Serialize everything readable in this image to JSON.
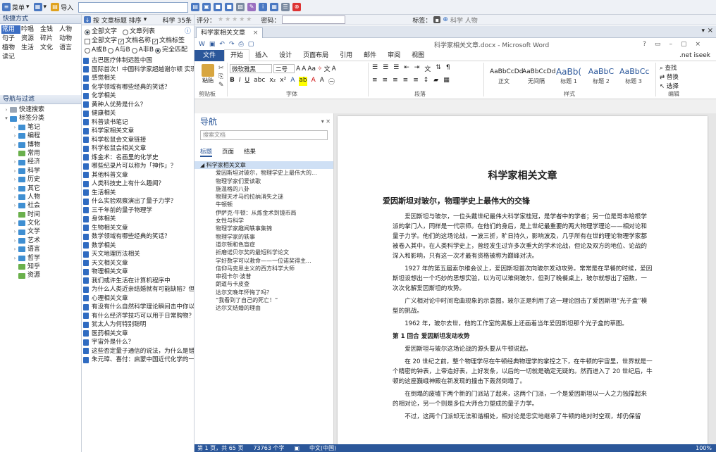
{
  "toolbar": {
    "menu": "菜单",
    "import": "导入"
  },
  "quick": {
    "title": "快捷方式",
    "items": [
      "常用",
      "吟唱",
      "金钱",
      "人物",
      "句子",
      "资源",
      "碎片",
      "动物",
      "植物",
      "生活",
      "文化",
      "语言",
      "读记"
    ],
    "selected": 0
  },
  "nav_filter": {
    "title": "导航与过滤",
    "nodes": [
      {
        "label": "快速搜索",
        "level": 0,
        "arrow": ">",
        "kind": "grey"
      },
      {
        "label": "标签分类",
        "level": 0,
        "arrow": "v",
        "kind": "folder"
      },
      {
        "label": "笔记",
        "level": 1,
        "arrow": ">",
        "kind": "folder"
      },
      {
        "label": "编程",
        "level": 1,
        "arrow": ">",
        "kind": "folder"
      },
      {
        "label": "博物",
        "level": 1,
        "arrow": ">",
        "kind": "folder"
      },
      {
        "label": "常用",
        "level": 1,
        "arrow": "",
        "kind": "leaf"
      },
      {
        "label": "经济",
        "level": 1,
        "arrow": ">",
        "kind": "folder"
      },
      {
        "label": "科学",
        "level": 1,
        "arrow": ">",
        "kind": "folder"
      },
      {
        "label": "历史",
        "level": 1,
        "arrow": ">",
        "kind": "folder"
      },
      {
        "label": "其它",
        "level": 1,
        "arrow": ">",
        "kind": "folder"
      },
      {
        "label": "人物",
        "level": 1,
        "arrow": ">",
        "kind": "folder"
      },
      {
        "label": "社会",
        "level": 1,
        "arrow": ">",
        "kind": "folder"
      },
      {
        "label": "时间",
        "level": 1,
        "arrow": "",
        "kind": "leaf"
      },
      {
        "label": "文化",
        "level": 1,
        "arrow": ">",
        "kind": "folder"
      },
      {
        "label": "文学",
        "level": 1,
        "arrow": ">",
        "kind": "folder"
      },
      {
        "label": "艺术",
        "level": 1,
        "arrow": ">",
        "kind": "folder"
      },
      {
        "label": "语言",
        "level": 1,
        "arrow": ">",
        "kind": "folder"
      },
      {
        "label": "哲学",
        "level": 1,
        "arrow": ">",
        "kind": "folder"
      },
      {
        "label": "知乎",
        "level": 1,
        "arrow": "",
        "kind": "leaf"
      },
      {
        "label": "资源",
        "level": 1,
        "arrow": "",
        "kind": "leaf"
      }
    ]
  },
  "list": {
    "sort": "按 文章标题 排序",
    "count": "科学 35条",
    "opt_all_text": "全部文字",
    "opt_list": "文章列表",
    "chk_all": "全部文字",
    "chk_name": "文档名称",
    "chk_tag": "文档标签",
    "match": [
      "A或B",
      "A与B",
      "A非B",
      "完全匹配"
    ],
    "docs": [
      "古巴医疗体制远胜中国",
      "国际首次！中国科学家超越谢尔顿 实现金融",
      "感觉相关",
      "化学领域有哪些经典的笑话？",
      "化学相关",
      "黄种人优势是什么？",
      "健康相关",
      "科普读书笔记",
      "科学家相关文章",
      "科学松鼠会文章链接",
      "科学松鼠会相关文章",
      "炼金术：名画里的化学史",
      "哪些纪录片可以称为「神作」？",
      "其他科普文章",
      "人类科技史上有什么趣闻？",
      "生活相关",
      "什么实验观察演出了量子力学？",
      "三千年前的量子物理学",
      "身体相关",
      "生物相关文章",
      "数学领域有哪些经典的笑话？",
      "数学相关",
      "天文地理历法相关",
      "天文相关文章",
      "物理相关文章",
      "我们或许生活在计算机程序中",
      "为什么人类近亲结婚就有可能缺陷？但动",
      "心理相关文章",
      "有没有什么自然科学理论瞬间击中你以至于",
      "有什么经济学技巧可以用于日常购物？",
      "犹太人为何特别聪明",
      "医药相关文章",
      "宇宙外是什么？",
      "这些否定量子通信的说法，为什么是错的？",
      "朱元璋、喜付：启蒙中国近代化学的一般林"
    ]
  },
  "rightbar": {
    "rating": "评分：",
    "password": "密码：",
    "tag": "标签：",
    "tag_value": "科学 人物"
  },
  "doctab": "科学家相关文章",
  "word": {
    "title": "科学家相关文章.docx - Microsoft Word",
    "user": ".net iseek",
    "menu": [
      "文件",
      "开始",
      "插入",
      "设计",
      "页面布局",
      "引用",
      "邮件",
      "审阅",
      "视图"
    ],
    "font": "微软雅黑",
    "size": "二号",
    "groups": {
      "clipboard": "剪贴板",
      "font": "字体",
      "paragraph": "段落",
      "styles": "样式",
      "edit": "编辑"
    },
    "paste": "粘贴",
    "styles": [
      {
        "prev": "AaBbCcDd",
        "name": "正文"
      },
      {
        "prev": "AaBbCcDd",
        "name": "无间隔"
      },
      {
        "prev": "AaBb(",
        "name": "标题 1"
      },
      {
        "prev": "AaBbC",
        "name": "标题 2"
      },
      {
        "prev": "AaBbCc",
        "name": "标题 3"
      }
    ],
    "edit": [
      "查找",
      "替换",
      "选择"
    ],
    "nav": {
      "title": "导航",
      "search_placeholder": "搜索文档",
      "tabs": [
        "标题",
        "页面",
        "结果"
      ],
      "root": "科学家相关文章",
      "items": [
        "爱因斯坦对玻尔，物理学史上最伟大的...",
        "物理学家们爱读歌",
        "施温格的八卦",
        "物理天才马约拉纳消失之谜",
        "牛顿顿",
        "伊萨克·牛顿：从炼金术到镜币局",
        "女性与科学",
        "物理学家趣闻轶事集锦",
        "物理学家的轶事",
        "道尔顿和色盲症",
        "折磨诺贝尔奖的最短科学论文",
        "学好数学可以救命——一位诺奖得主...",
        "信仰马克思主义的西方科学大师",
        "审视卡尔·波普",
        "朗道与卡皮查",
        "达尔文晚年怀悔了吗？",
        "“我看到了自己的死亡！”",
        "达尔文结婚的理由"
      ]
    },
    "doc": {
      "title": "科学家相关文章",
      "h2": "爱因斯坦对玻尔，物理学史上最伟大的交锋",
      "paras": [
        "爱因斯坦与玻尔，一位头戴世纪最伟大科学家桂冠，是学者中的学者；另一位是哥本哈根学派的掌门人，同样是一代宗师。在他们的身后，是上世纪最重要的两大物理学理论——相对论和量子力学。他们的这场论战，一波三折，旷日持久，影响波及，几乎所有在世的理论物理学家都被卷入其中。在人类科学史上，曾经发生过许多次重大的学术论战，但论及双方的地位、论战的深入和影响，只有这一次才最有资格被称为巅峰对决。",
        "1927 年的第五届索尔维会议上，爱因斯坦首次向玻尔发动攻势。常常是在早餐的时候，爱因斯坦设想出一个巧妙的思想实验，以为可以难倒玻尔，但到了晚餐桌上，玻尔就想出了招数，一次次化解爱因斯坦的攻势。",
        "广义相对论中时间弯曲现象的示意图。玻尔正是利用了这一理论回击了爱因斯坦“光子盒”模型的挑战。",
        "1962 年，玻尔去世，他的工作室的黑板上还画着当年爱因斯坦那个光子盒的草图。"
      ],
      "h3": "第 1 回合 爱因斯坦发动攻势",
      "paras2": [
        "爱因斯坦与玻尔这场论战的源头要从牛顿说起。",
        "在 20 世纪之前，整个物理学尽在牛顿经典物理学的掌控之下，在牛顿的宇宙里，世界就是一个精密的钟表，上帝造好表，上好发条，以后的一切就是确定无疑的。然而进入了 20 世纪后，牛顿的这座巍峨神殿在新发现的撞击下轰然倒塌了。",
        "在倒塌的废墟下两个新的门派站了起来，这两个门派，一个是爱因斯坦以一人之力独撑起来的相对论，另一个则是多位大师合力塑成的量子力学。",
        "不过，这两个门派却无法和谐相处，相对论是忠实地继承了牛顿的绝对时空观，却仍保留"
      ]
    },
    "status": {
      "page": "第 1 页，共 65 页",
      "words": "73763 个字",
      "lang": "中文(中国)",
      "zoom": "100%"
    }
  },
  "colors": {
    "accent": "#2b579a",
    "select": "#3d6fc4"
  }
}
